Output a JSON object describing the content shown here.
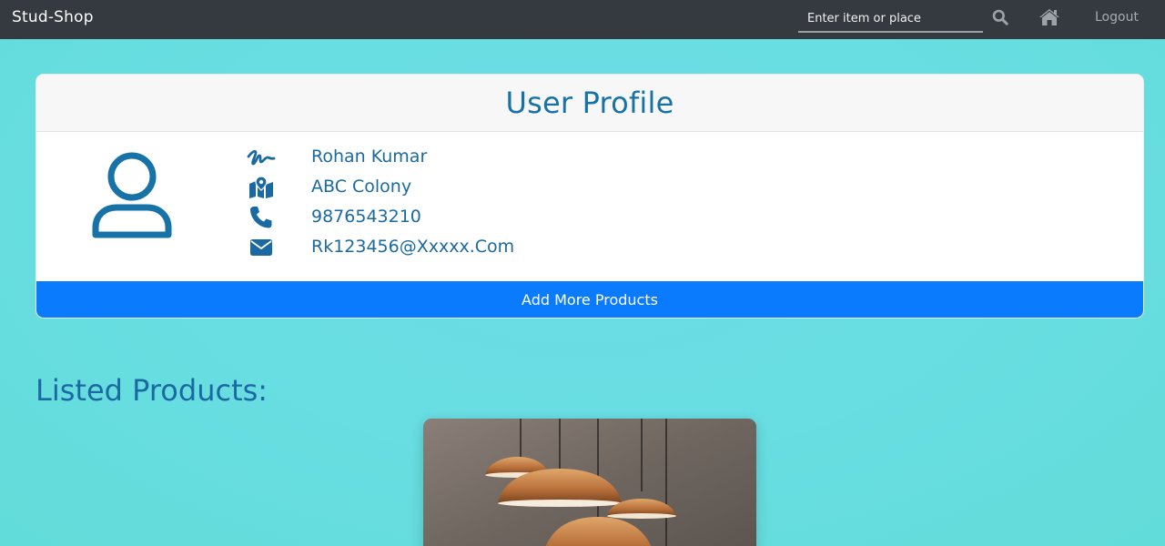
{
  "navbar": {
    "brand": "Stud-Shop",
    "search_placeholder": "Enter item or place",
    "search_icon": "search-icon",
    "home_icon": "home-icon",
    "logout_label": "Logout"
  },
  "profile": {
    "title": "User Profile",
    "avatar_icon": "user-icon",
    "fields": [
      {
        "icon": "signature-icon",
        "value": "Rohan Kumar"
      },
      {
        "icon": "map-icon",
        "value": "ABC Colony"
      },
      {
        "icon": "phone-icon",
        "value": "9876543210"
      },
      {
        "icon": "envelope-icon",
        "value": "Rk123456@Xxxxx.Com"
      }
    ],
    "add_button_label": "Add More Products"
  },
  "products": {
    "section_title": "Listed Products:",
    "items": [
      {
        "image": "pendant-lamps"
      }
    ]
  },
  "colors": {
    "navbar": "#343a40",
    "accent": "#1a6aa1",
    "button": "#0b7bfd",
    "background": "#68dde2"
  }
}
